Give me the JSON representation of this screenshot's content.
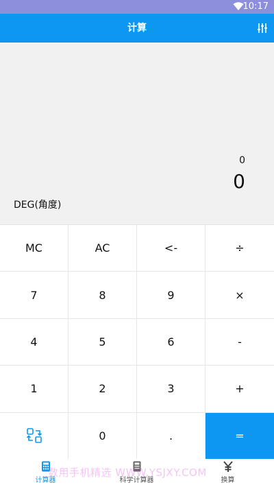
{
  "status_bar": {
    "time": "10:17"
  },
  "app_bar": {
    "title": "计算"
  },
  "display": {
    "expression": "0",
    "result": "0",
    "angle_mode": "DEG(角度)"
  },
  "keypad": {
    "mc": "MC",
    "ac": "AC",
    "backspace": "<-",
    "divide": "÷",
    "seven": "7",
    "eight": "8",
    "nine": "9",
    "multiply": "×",
    "four": "4",
    "five": "5",
    "six": "6",
    "minus": "-",
    "one": "1",
    "two": "2",
    "three": "3",
    "plus": "+",
    "zero": "0",
    "dot": ".",
    "equals": "="
  },
  "tabs": [
    {
      "label": "计算器",
      "icon": "calculator-icon"
    },
    {
      "label": "科学计算器",
      "icon": "scientific-calculator-icon"
    },
    {
      "label": "换算",
      "icon": "yen-icon"
    }
  ],
  "watermark": "数用手机精选 WWW.YSJXY.COM",
  "colors": {
    "accent": "#0d97f3",
    "status_bar": "#8d8edc",
    "display_bg": "#f1f1f1"
  }
}
